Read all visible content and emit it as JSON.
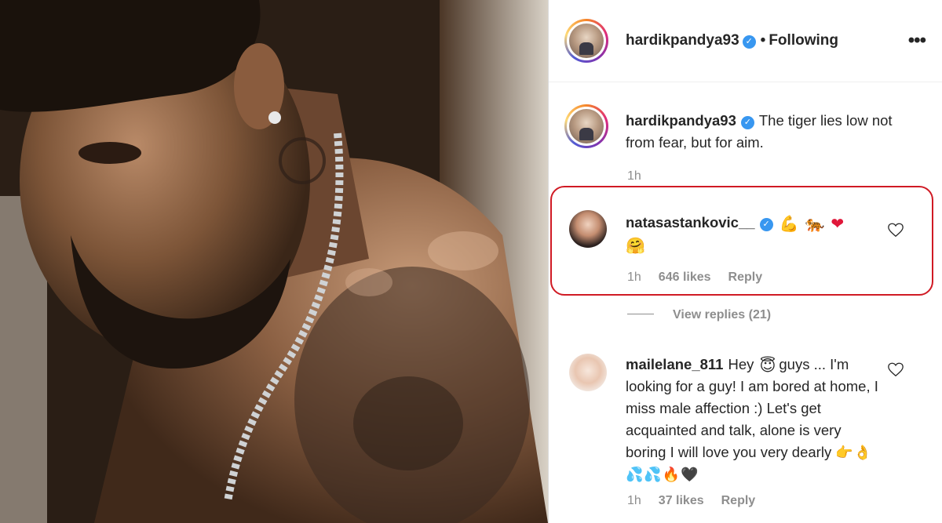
{
  "post": {
    "author": "hardikpandya93",
    "follow_status": "Following",
    "more_icon": "more-options-icon",
    "caption": "The tiger lies low not from fear, but for aim.",
    "caption_time": "1h"
  },
  "comments": [
    {
      "username": "natasastankovic__",
      "text": "",
      "emojis": [
        "💪",
        "🐅",
        "❤",
        "🤗"
      ],
      "time": "1h",
      "likes": "646 likes",
      "reply": "Reply",
      "view_replies": "View replies (21)"
    },
    {
      "username": "mailelane_811",
      "text_parts": [
        "Hey",
        "guys ... I'm looking for a guy! I am bored at home, I miss male affection :) Let's get acquainted and talk, alone is very boring I will love you very dearly"
      ],
      "emoji_inline": "😇",
      "emoji_tail": "👉👌💦💦🔥🖤",
      "time": "1h",
      "likes": "37 likes",
      "reply": "Reply"
    }
  ],
  "colors": {
    "verified": "#3897f0",
    "highlight": "#d01a24",
    "meta": "#8e8e8e"
  }
}
